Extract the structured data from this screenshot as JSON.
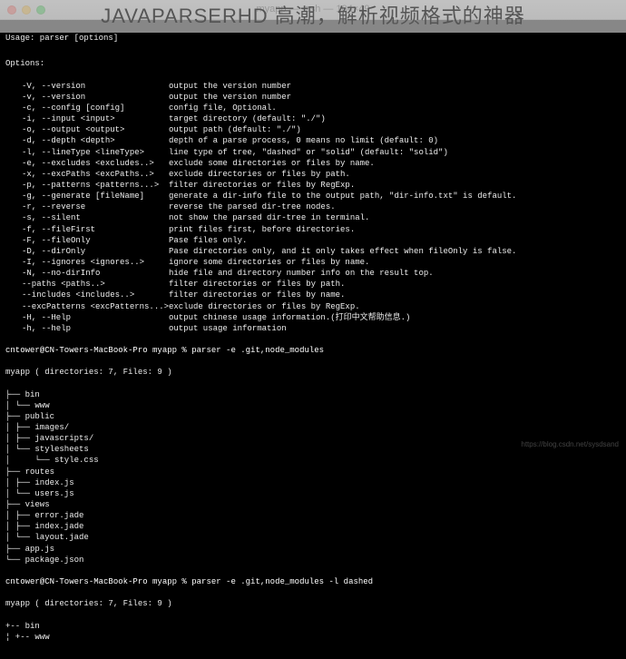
{
  "overlay_text": "JAVAPARSERHD 高潮，解析视频格式的神器",
  "titlebar": {
    "left_prompt": "cntower@CN-Towers-MacBc",
    "center": "myapp — -zsh — 104×49"
  },
  "usage_line": "Usage: parser [options]",
  "options_header": "Options:",
  "options": [
    {
      "flag": "-V, --version",
      "desc": "output the version number"
    },
    {
      "flag": "-v, --version",
      "desc": "output the version number"
    },
    {
      "flag": "-c, --config [config]",
      "desc": "config file, Optional."
    },
    {
      "flag": "-i, --input <input>",
      "desc": "target directory (default: \"./\")"
    },
    {
      "flag": "-o, --output <output>",
      "desc": "output path (default: \"./\")"
    },
    {
      "flag": "-d, --depth <depth>",
      "desc": "depth of a parse process, 0 means no limit (default: 0)"
    },
    {
      "flag": "-l, --lineType <lineType>",
      "desc": "line type of tree, \"dashed\" or \"solid\" (default: \"solid\")"
    },
    {
      "flag": "-e, --excludes <excludes..>",
      "desc": "exclude some directories or files by name."
    },
    {
      "flag": "-x, --excPaths <excPaths..>",
      "desc": "exclude directories or files by path."
    },
    {
      "flag": "-p, --patterns <patterns...>",
      "desc": "filter directories or files by RegExp."
    },
    {
      "flag": "-g, --generate [fileName]",
      "desc": "generate a dir-info file to the output path, \"dir-info.txt\" is default."
    },
    {
      "flag": "-r, --reverse",
      "desc": "reverse the parsed dir-tree nodes."
    },
    {
      "flag": "-s, --silent",
      "desc": "not show the parsed dir-tree in terminal."
    },
    {
      "flag": "-f, --fileFirst",
      "desc": "print files first, before directories."
    },
    {
      "flag": "-F, --fileOnly",
      "desc": "Pase files only."
    },
    {
      "flag": "-D, --dirOnly",
      "desc": "Pase directories only, and it only takes effect when fileOnly is false."
    },
    {
      "flag": "-I, --ignores <ignores..>",
      "desc": "ignore some directories or files by name."
    },
    {
      "flag": "-N, --no-dirInfo",
      "desc": "hide file and directory number info on the result top."
    },
    {
      "flag": "--paths <paths..>",
      "desc": "filter directories or files by path."
    },
    {
      "flag": "--includes <includes..>",
      "desc": "filter directories or files by name."
    },
    {
      "flag": "--excPatterns <excPatterns...>",
      "desc": "exclude directories or files by RegExp."
    },
    {
      "flag": "-H, --Help",
      "desc": "output chinese usage information.(打印中文帮助信息.)"
    },
    {
      "flag": "-h, --help",
      "desc": "output usage information"
    }
  ],
  "cmd1": {
    "prompt": "cntower@CN-Towers-MacBook-Pro myapp %",
    "command": "parser -e .git,node_modules"
  },
  "tree1_header": "myapp ( directories: 7, Files: 9 )",
  "tree1": [
    "├── bin",
    "│ └── www",
    "├── public",
    "│ ├── images/",
    "│ ├── javascripts/",
    "│ └── stylesheets",
    "│     └── style.css",
    "├── routes",
    "│ ├── index.js",
    "│ └── users.js",
    "├── views",
    "│ ├── error.jade",
    "│ ├── index.jade",
    "│ └── layout.jade",
    "├── app.js",
    "└── package.json"
  ],
  "cmd2": {
    "prompt": "cntower@CN-Towers-MacBook-Pro myapp %",
    "command": "parser -e .git,node_modules -l dashed"
  },
  "tree2_header": "myapp ( directories: 7, Files: 9 )",
  "tree2": [
    "+-- bin",
    "¦ +-- www"
  ],
  "watermark": "https://blog.csdn.net/sysdsand"
}
